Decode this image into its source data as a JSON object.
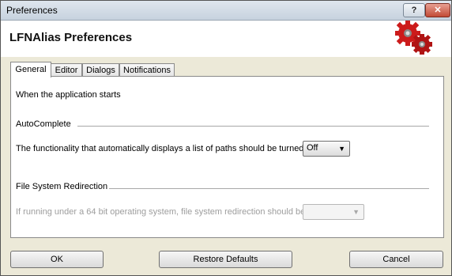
{
  "window": {
    "title": "Preferences"
  },
  "titlebar": {
    "help_label": "?",
    "close_label": "✕"
  },
  "header": {
    "title": "LFNAlias Preferences"
  },
  "tabs": [
    {
      "label": "General",
      "active": true
    },
    {
      "label": "Editor",
      "active": false
    },
    {
      "label": "Dialogs",
      "active": false
    },
    {
      "label": "Notifications",
      "active": false
    }
  ],
  "general": {
    "startup_text": "When the application starts",
    "autocomplete": {
      "section_label": "AutoComplete",
      "description": "The functionality that automatically displays a list of paths should be turned",
      "value": "Off"
    },
    "redirection": {
      "section_label": "File System Redirection",
      "description": "If running under a 64 bit operating system, file system redirection should be",
      "value": ""
    }
  },
  "footer": {
    "ok_label": "OK",
    "restore_label": "Restore Defaults",
    "cancel_label": "Cancel"
  },
  "colors": {
    "gear_primary": "#cc1b1b",
    "gear_secondary": "#b01414"
  },
  "icons": {
    "app_logo": "gears-icon",
    "dropdown": "chevron-down-icon"
  }
}
